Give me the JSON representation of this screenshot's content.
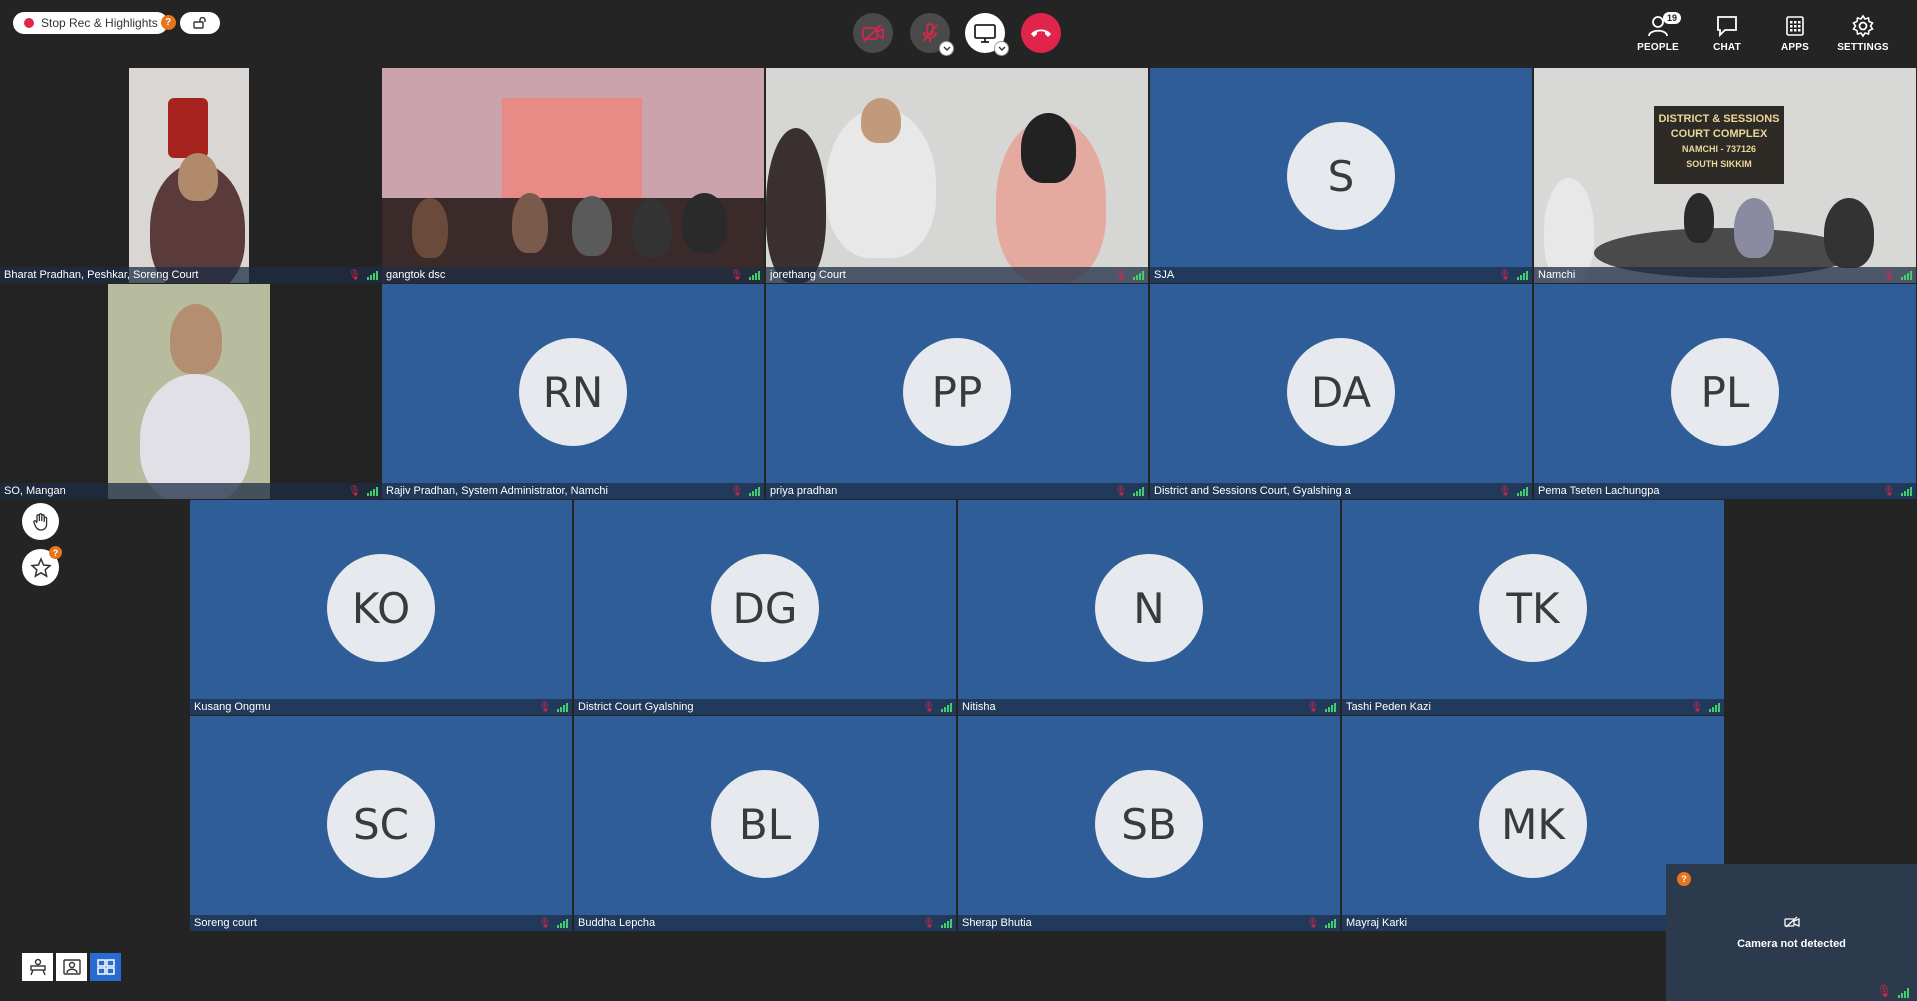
{
  "topbar": {
    "record_label": "Stop Rec & Highlights",
    "record_help": "?",
    "people_label": "PEOPLE",
    "people_count": "19",
    "chat_label": "CHAT",
    "apps_label": "APPS",
    "settings_label": "SETTINGS"
  },
  "tiles": [
    {
      "name": "Bharat Pradhan, Peshkar, Soreng Court",
      "initials": ""
    },
    {
      "name": "gangtok dsc",
      "initials": ""
    },
    {
      "name": "jorethang Court",
      "initials": ""
    },
    {
      "name": "SJA",
      "initials": "S"
    },
    {
      "name": "Namchi",
      "initials": ""
    },
    {
      "name": "SO, Mangan",
      "initials": ""
    },
    {
      "name": "Rajiv Pradhan, System Administrator, Namchi",
      "initials": "RN"
    },
    {
      "name": "priya pradhan",
      "initials": "PP"
    },
    {
      "name": "District and Sessions Court, Gyalshing a",
      "initials": "DA"
    },
    {
      "name": "Pema Tseten Lachungpa",
      "initials": "PL"
    },
    {
      "name": "Kusang Ongmu",
      "initials": "KO"
    },
    {
      "name": "District Court Gyalshing",
      "initials": "DG"
    },
    {
      "name": "Nitisha",
      "initials": "N"
    },
    {
      "name": "Tashi Peden Kazi",
      "initials": "TK"
    },
    {
      "name": "Soreng court",
      "initials": "SC"
    },
    {
      "name": "Buddha Lepcha",
      "initials": "BL"
    },
    {
      "name": "Sherap Bhutia",
      "initials": "SB"
    },
    {
      "name": "Mayraj Karki",
      "initials": "MK"
    }
  ],
  "namchi_sign": {
    "line1": "DISTRICT & SESSIONS",
    "line2": "COURT COMPLEX",
    "line3": "NAMCHI - 737126",
    "line4": "SOUTH SIKKIM"
  },
  "sidebar": {
    "star_help": "?"
  },
  "selfview": {
    "message": "Camera not detected",
    "help": "?"
  },
  "colors": {
    "tile_bg": "#2f5d97",
    "accent": "#e0244b",
    "signal": "#3fd06a",
    "layout_active": "#2a6bd2"
  }
}
